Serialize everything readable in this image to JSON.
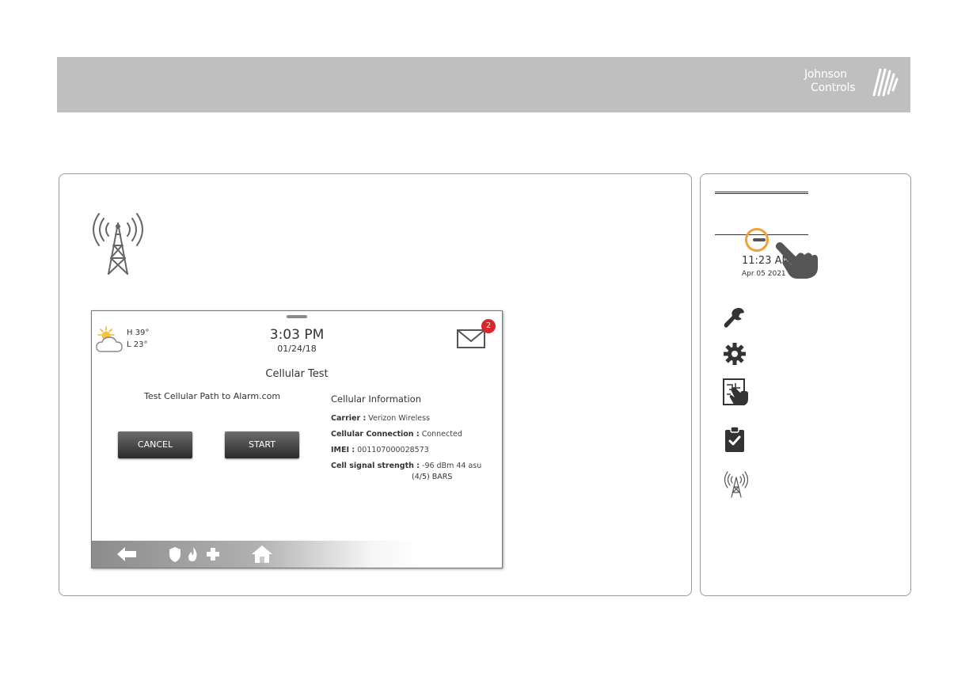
{
  "brand": {
    "line1": "Johnson",
    "line2": "Controls"
  },
  "screen": {
    "weather": {
      "high": "H 39°",
      "low": "L 23°",
      "icon": "partly-cloudy-icon"
    },
    "time": "3:03 PM",
    "date": "01/24/18",
    "message_count": "2",
    "title": "Cellular Test",
    "test_label": "Test Cellular Path to Alarm.com",
    "buttons": {
      "cancel": "CANCEL",
      "start": "START"
    },
    "info": {
      "heading": "Cellular Information",
      "carrier_label": "Carrier :",
      "carrier_value": "Verizon Wireless",
      "connection_label": "Cellular Connection :",
      "connection_value": "Connected",
      "imei_label": "IMEI :",
      "imei_value": "001107000028573",
      "signal_label": "Cell signal strength :",
      "signal_value": "-96 dBm 44 asu",
      "signal_bars": "(4/5) BARS"
    },
    "bottom_nav": [
      "back-arrow-icon",
      "shield-icon",
      "fire-icon",
      "medical-cross-icon",
      "home-icon"
    ]
  },
  "sidebar": {
    "time": "11:23 AM",
    "date": "Apr 05 2021",
    "icons": [
      "wrench-icon",
      "gear-icon",
      "panel-touch-icon",
      "clipboard-check-icon",
      "cell-tower-icon"
    ]
  },
  "colors": {
    "topbar": "#bfbfbf",
    "badge": "#d9262b",
    "highlight_ring": "#f0a03a"
  }
}
